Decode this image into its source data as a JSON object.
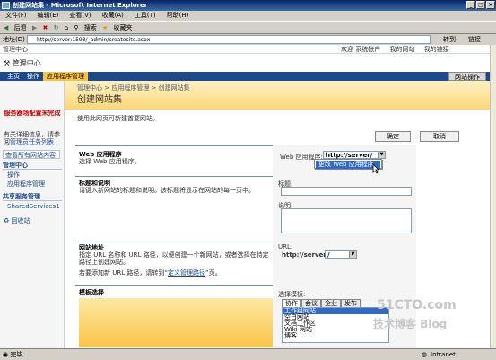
{
  "window": {
    "title": "创建网站集 - Microsoft Internet Explorer"
  },
  "menu": [
    "文件(F)",
    "编辑(E)",
    "查看(V)",
    "收藏(A)",
    "工具(T)",
    "帮助(H)"
  ],
  "toolbar": {
    "back": "后退",
    "search": "搜索",
    "favorites": "收藏夹"
  },
  "address": {
    "label": "地址(D)",
    "url": "http://server:1593/_admin/createsite.aspx",
    "go": "转到",
    "links": "链接"
  },
  "top": {
    "site": "管理中心",
    "links": [
      "欢迎 系统帐户",
      "我的网站",
      "我的链接"
    ]
  },
  "brand": "管理中心",
  "tabs": [
    {
      "label": "主页"
    },
    {
      "label": "操作"
    },
    {
      "label": "应用程序管理",
      "active": true
    }
  ],
  "site_actions": "网站操作",
  "leftnav": {
    "warning": "服务器场配置未完成",
    "info_text": "有关详细信息，请参阅",
    "info_link": "管理员任务列表",
    "view_all": "查看所有网站内容",
    "head1": "管理中心",
    "items1": [
      "操作",
      "应用程序管理"
    ],
    "head2": "共享服务管理",
    "items2": [
      "SharedServices1"
    ],
    "recycle": "回收站"
  },
  "breadcrumb": "管理中心 > 应用程序管理 > 创建网站集",
  "page_title": "创建网站集",
  "description": "使用此网页可新建首要网站。",
  "buttons": {
    "ok": "确定",
    "cancel": "取消"
  },
  "sections": {
    "webapp": {
      "title": "Web 应用程序",
      "desc": "选择 Web 应用程序。",
      "label": "Web 应用程序:",
      "value": "http://server/",
      "menu_item": "更改 Web 应用程序"
    },
    "title_desc": {
      "title": "标题和说明",
      "desc": "请键入新网站的标题和说明。该标题将显示在网站的每一页中。",
      "title_label": "标题:",
      "desc_label": "说明:"
    },
    "url": {
      "title": "网站地址",
      "desc": "指定 URL 名称和 URL 路径，以便创建一个新网站，或者选择在特定路径上创建网站。",
      "desc2": "若要添加新 URL 路径，请转到“",
      "link": "定义管理路径",
      "desc3": "”页。",
      "url_label": "URL:",
      "prefix": "http://server",
      "path": "/"
    },
    "template": {
      "title": "模板选择",
      "label": "选择模板:",
      "tabs": [
        "协作",
        "会议",
        "企业",
        "发布"
      ],
      "items": [
        "工作组网站",
        "空白网站",
        "文档工作区",
        "Wiki 网站",
        "博客"
      ]
    }
  },
  "status": {
    "left": "完毕",
    "zone": "Intranet"
  },
  "watermark": {
    "top": "51CTO.com",
    "bottom": "技术博客  Blog"
  }
}
